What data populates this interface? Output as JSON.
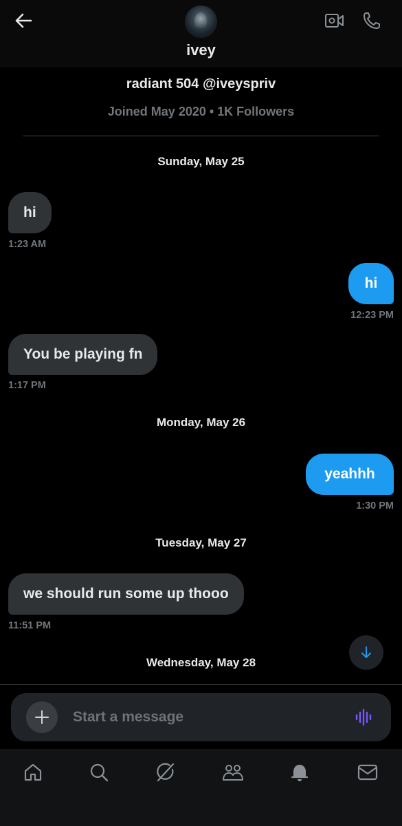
{
  "header": {
    "name": "ivey",
    "icons": {
      "back": "arrow-left-icon",
      "video": "video-camera-icon",
      "call": "phone-icon"
    }
  },
  "profile": {
    "display_line": "radiant 504 @iveyspriv",
    "joined_line": "Joined May 2020 • 1K Followers"
  },
  "conversation": {
    "dates": [
      "Sunday, May 25",
      "Monday, May 26",
      "Tuesday, May 27",
      "Wednesday, May 28"
    ],
    "messages": [
      {
        "direction": "received",
        "text": "hi",
        "time": "1:23 AM"
      },
      {
        "direction": "sent",
        "text": "hi",
        "time": "12:23 PM"
      },
      {
        "direction": "received",
        "text": "You be playing fn",
        "time": "1:17 PM"
      },
      {
        "direction": "sent",
        "text": "yeahhh",
        "time": "1:30 PM"
      },
      {
        "direction": "received",
        "text": "we should run some up thooo",
        "time": "11:51 PM"
      }
    ]
  },
  "composer": {
    "placeholder": "Start a message",
    "value": "",
    "icons": {
      "add": "plus-icon",
      "voice": "voice-wave-icon"
    },
    "voice_color": "#7856ff"
  },
  "scroll_button_icon": "arrow-down-icon",
  "bottom_nav": {
    "items": [
      "home-icon",
      "search-icon",
      "grok-icon",
      "communities-icon",
      "notifications-icon",
      "messages-icon"
    ]
  },
  "colors": {
    "sent_bubble": "#1d9bf0",
    "received_bubble": "#2f3336",
    "muted_text": "#71767b",
    "background": "#000000"
  }
}
